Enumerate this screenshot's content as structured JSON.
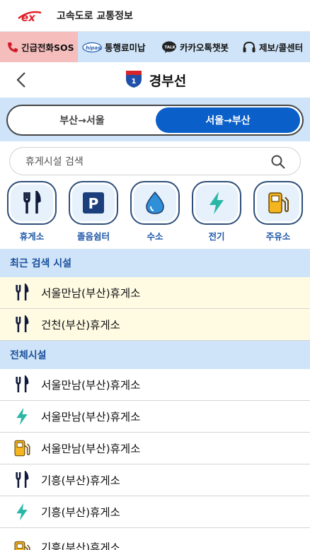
{
  "topbar": {
    "title": "고속도로 교통정보",
    "logo_icon": "ex-logo-icon"
  },
  "quickbar": {
    "items": [
      {
        "label": "긴급전화SOS",
        "icon": "phone-icon"
      },
      {
        "label": "통행료미납",
        "icon": "hipass-icon"
      },
      {
        "label": "카카오톡챗봇",
        "icon": "kakaotalk-icon"
      },
      {
        "label": "제보/콜센터",
        "icon": "headset-icon"
      }
    ],
    "emergency_color": "#f6bdbd"
  },
  "header": {
    "route_number": "1",
    "title": "경부선"
  },
  "direction": {
    "left": "부산→서울",
    "right": "서울→부산",
    "selected": "right",
    "accent": "#0a5fc8"
  },
  "search": {
    "placeholder": "휴게시설 검색"
  },
  "categories": [
    {
      "label": "휴게소",
      "icon": "fork-knife-icon"
    },
    {
      "label": "졸음쉼터",
      "icon": "parking-icon"
    },
    {
      "label": "수소",
      "icon": "water-drop-icon"
    },
    {
      "label": "전기",
      "icon": "lightning-icon"
    },
    {
      "label": "주유소",
      "icon": "fuel-pump-icon"
    }
  ],
  "recent": {
    "title": "최근 검색 시설",
    "items": [
      {
        "label": "서울만남(부산)휴게소",
        "icon": "fork-knife-icon"
      },
      {
        "label": "건천(부산)휴게소",
        "icon": "fork-knife-icon"
      }
    ]
  },
  "all": {
    "title": "전체시설",
    "items": [
      {
        "label": "서울만남(부산)휴게소",
        "icon": "fork-knife-icon"
      },
      {
        "label": "서울만남(부산)휴게소",
        "icon": "lightning-icon"
      },
      {
        "label": "서울만남(부산)휴게소",
        "icon": "fuel-pump-icon"
      },
      {
        "label": "기흥(부산)휴게소",
        "icon": "fork-knife-icon"
      },
      {
        "label": "기흥(부산)휴게소",
        "icon": "lightning-icon"
      },
      {
        "label": "기흥(부산)휴게소",
        "icon": "fuel-pump-icon"
      }
    ]
  }
}
